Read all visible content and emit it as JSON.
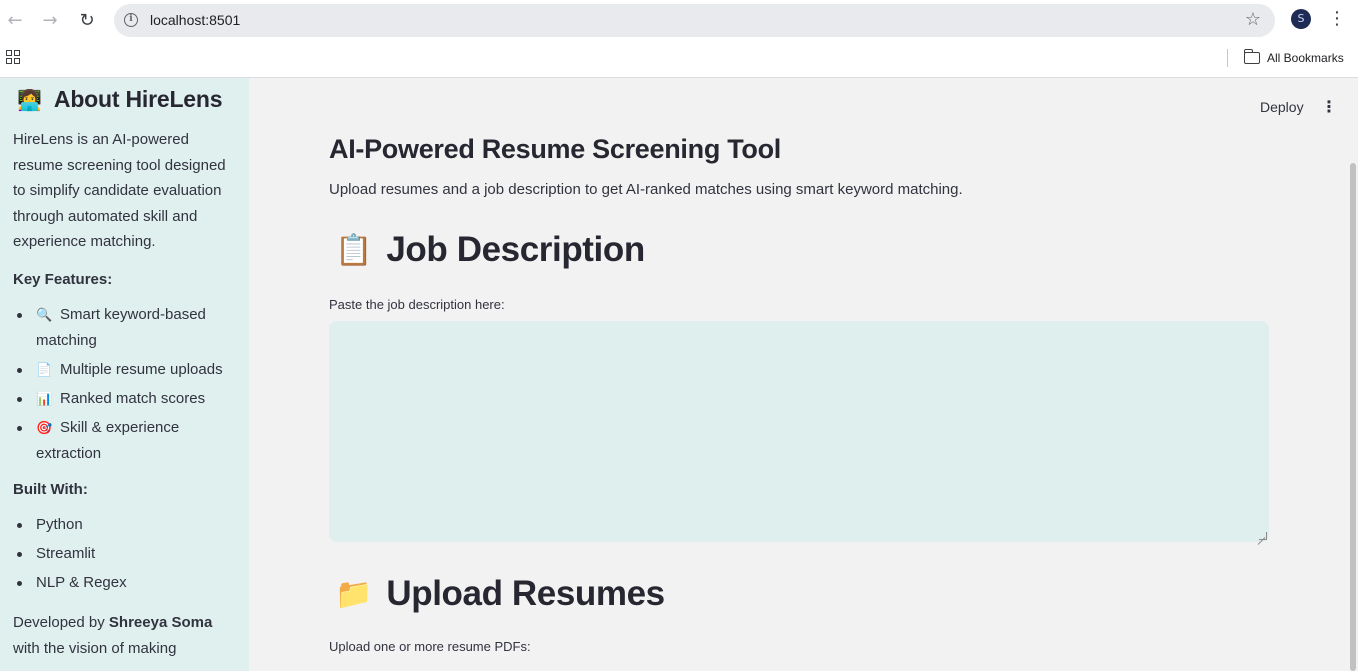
{
  "browser": {
    "url": "localhost:8501",
    "profile_initial": "S",
    "all_bookmarks": "All Bookmarks"
  },
  "sidebar": {
    "emoji": "👩‍💻",
    "title": "About HireLens",
    "description": "HireLens is an AI-powered resume screening tool designed to simplify candidate evaluation through automated skill and experience matching.",
    "features_label": "Key Features:",
    "features": [
      {
        "icon": "🔍",
        "text": "Smart keyword-based matching"
      },
      {
        "icon": "📄",
        "text": "Multiple resume uploads"
      },
      {
        "icon": "📊",
        "text": "Ranked match scores"
      },
      {
        "icon": "🎯",
        "text": "Skill & experience extraction"
      }
    ],
    "built_label": "Built With:",
    "built_with": [
      "Python",
      "Streamlit",
      "NLP & Regex"
    ],
    "dev_prefix": "Developed by ",
    "dev_name": "Shreeya Soma",
    "dev_suffix": " with the vision of making"
  },
  "header": {
    "deploy_label": "Deploy"
  },
  "main": {
    "title": "AI-Powered Resume Screening Tool",
    "subtitle": "Upload resumes and a job description to get AI-ranked matches using smart keyword matching.",
    "jd_emoji": "📋",
    "jd_heading": "Job Description",
    "jd_label": "Paste the job description here:",
    "jd_value": "",
    "upload_emoji": "📁",
    "upload_heading": "Upload Resumes",
    "upload_label": "Upload one or more resume PDFs:"
  }
}
